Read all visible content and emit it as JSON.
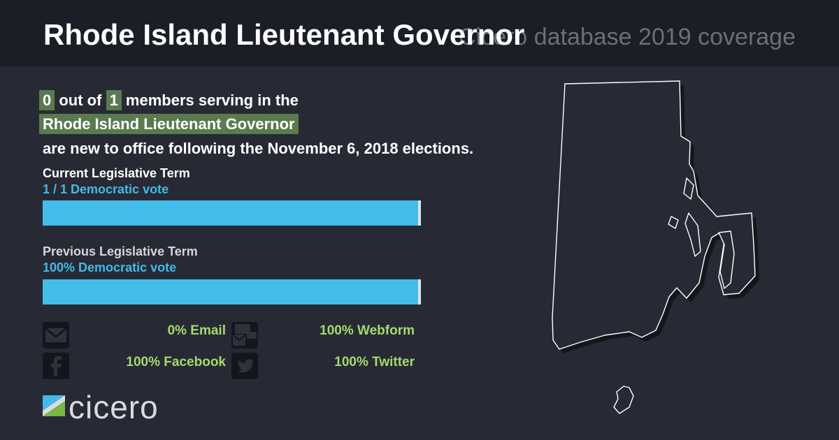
{
  "header": {
    "title": "Rhode Island Lieutenant Governor",
    "subtitle": "Cicero database 2019 coverage"
  },
  "summary": {
    "new_count": "0",
    "out_of": " out of ",
    "total": "1",
    "line1_rest": " members serving in the",
    "body_name": "Rhode Island Lieutenant Governor",
    "line3": "are new to office following the November 6, 2018 elections."
  },
  "current_term": {
    "label": "Current Legislative Term",
    "value": "1 / 1 Democratic vote",
    "democratic_fraction": 1.0
  },
  "previous_term": {
    "label": "Previous Legislative Term",
    "value": "100% Democratic vote",
    "democratic_fraction": 1.0
  },
  "contacts": {
    "email": "0% Email",
    "webform": "100% Webform",
    "facebook": "100% Facebook",
    "twitter": "100% Twitter"
  },
  "logo": {
    "text": "cicero"
  },
  "colors": {
    "background": "#272a35",
    "header": "#1b1e26",
    "highlight": "#5a7a50",
    "democratic": "#44bce9",
    "stat": "#a6d96e"
  }
}
